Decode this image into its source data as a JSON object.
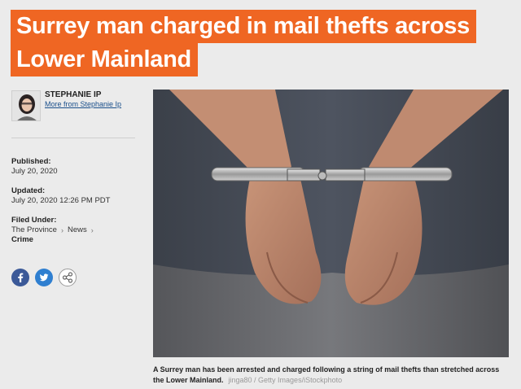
{
  "headline": {
    "line1": "Surrey man charged in mail thefts across",
    "line2": "Lower Mainland"
  },
  "author": {
    "name": "STEPHANIE IP",
    "more_link": "More from Stephanie Ip"
  },
  "meta": {
    "published_label": "Published:",
    "published_value": "July 20, 2020",
    "updated_label": "Updated:",
    "updated_value": "July 20, 2020 12:26 PM PDT",
    "filed_label": "Filed Under:",
    "categories": [
      "The Province",
      "News",
      "Crime"
    ]
  },
  "social": {
    "icons": [
      "facebook-icon",
      "twitter-icon",
      "share-icon"
    ],
    "colors": {
      "facebook": "#3b5998",
      "twitter": "#2f7fd0"
    }
  },
  "colors": {
    "accent": "#ef6623",
    "link": "#1a4f8b"
  },
  "photo": {
    "caption": "A Surrey man has been arrested and charged following a string of mail thefts than stretched across the Lower Mainland.",
    "credit": "jinga80 / Getty Images/iStockphoto"
  }
}
